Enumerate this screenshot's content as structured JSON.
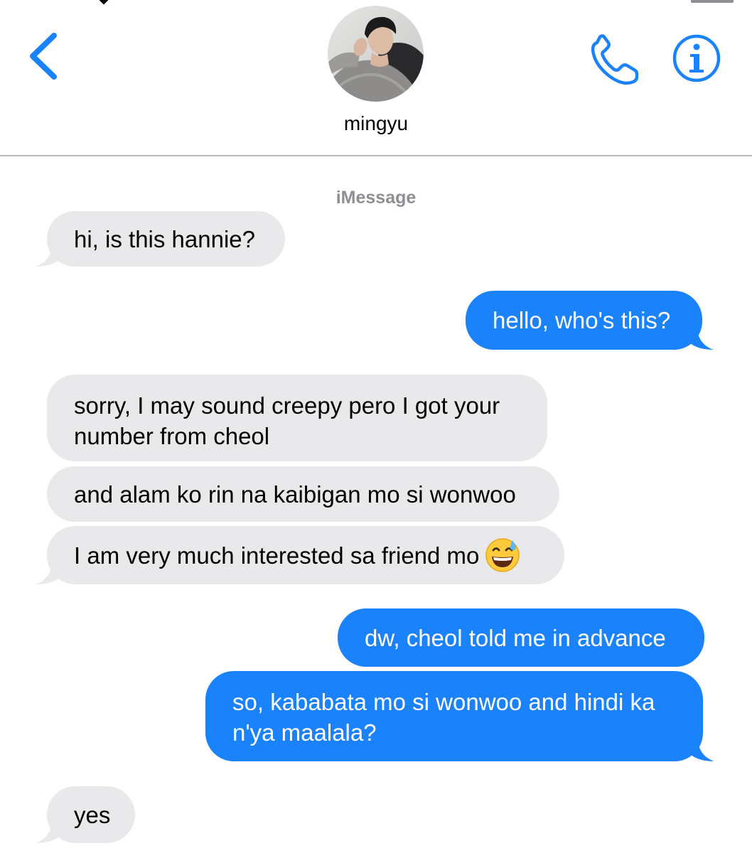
{
  "header": {
    "contact_name": "mingyu",
    "back_icon": "chevron-left-icon",
    "call_icon": "phone-icon",
    "info_icon": "info-icon",
    "accent_color": "#1a82fb"
  },
  "conversation": {
    "service_label": "iMessage",
    "messages": [
      {
        "direction": "incoming",
        "text": "hi, is this hannie?"
      },
      {
        "direction": "outgoing",
        "text": "hello, who's this?"
      },
      {
        "direction": "incoming",
        "text": "sorry, I may sound creepy pero I got your number from cheol"
      },
      {
        "direction": "incoming",
        "text": "and alam ko rin na kaibigan mo si wonwoo"
      },
      {
        "direction": "incoming",
        "text": "I am very much interested sa friend mo",
        "emoji": "😅"
      },
      {
        "direction": "outgoing",
        "text": "dw, cheol told me in advance"
      },
      {
        "direction": "outgoing",
        "text": "so, kababata mo si wonwoo and hindi ka n'ya maalala?"
      },
      {
        "direction": "incoming",
        "text": "yes"
      }
    ],
    "incoming_color": "#e9e9eb",
    "outgoing_color": "#1a82fb"
  }
}
